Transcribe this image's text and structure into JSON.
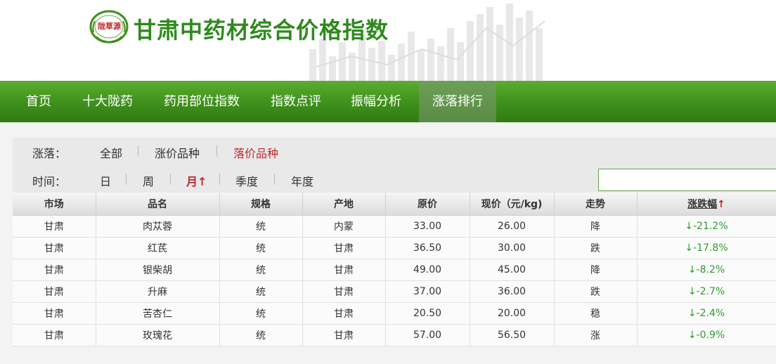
{
  "header": {
    "seal_text": "陇草源",
    "title": "甘肃中药材综合价格指数"
  },
  "colors": {
    "brand_green": "#3f8f1c",
    "title_green": "#2f8a1e",
    "active_red": "#c0282d",
    "down_green": "#2f9a2f"
  },
  "nav": {
    "items": [
      {
        "label": "首页"
      },
      {
        "label": "十大陇药"
      },
      {
        "label": "药用部位指数"
      },
      {
        "label": "指数点评"
      },
      {
        "label": "振幅分析"
      },
      {
        "label": "涨落排行",
        "active": true
      }
    ]
  },
  "filter": {
    "change_label": "涨落：",
    "change_options": [
      "全部",
      "涨价品种",
      "落价品种"
    ],
    "change_selected": "落价品种",
    "time_label": "时间：",
    "time_options": [
      "日",
      "周",
      "月↑",
      "季度",
      "年度"
    ],
    "time_selected": "月↑",
    "search_value": ""
  },
  "table": {
    "headers": [
      "市场",
      "品名",
      "规格",
      "产地",
      "原价",
      "现价（元/kg)",
      "走势"
    ],
    "sort_header": {
      "label": "涨跌幅",
      "arrow": "↑"
    },
    "rows": [
      [
        "甘肃",
        "肉苁蓉",
        "统",
        "内蒙",
        "33.00",
        "26.00",
        "降",
        "↓-21.2%"
      ],
      [
        "甘肃",
        "红芪",
        "统",
        "甘肃",
        "36.50",
        "30.00",
        "跌",
        "↓-17.8%"
      ],
      [
        "甘肃",
        "银柴胡",
        "统",
        "甘肃",
        "49.00",
        "45.00",
        "降",
        "↓-8.2%"
      ],
      [
        "甘肃",
        "升麻",
        "统",
        "甘肃",
        "37.00",
        "36.00",
        "跌",
        "↓-2.7%"
      ],
      [
        "甘肃",
        "苦杏仁",
        "统",
        "甘肃",
        "20.50",
        "20.00",
        "稳",
        "↓-2.4%"
      ],
      [
        "甘肃",
        "玫瑰花",
        "统",
        "甘肃",
        "57.00",
        "56.50",
        "涨",
        "↓-0.9%"
      ]
    ]
  }
}
